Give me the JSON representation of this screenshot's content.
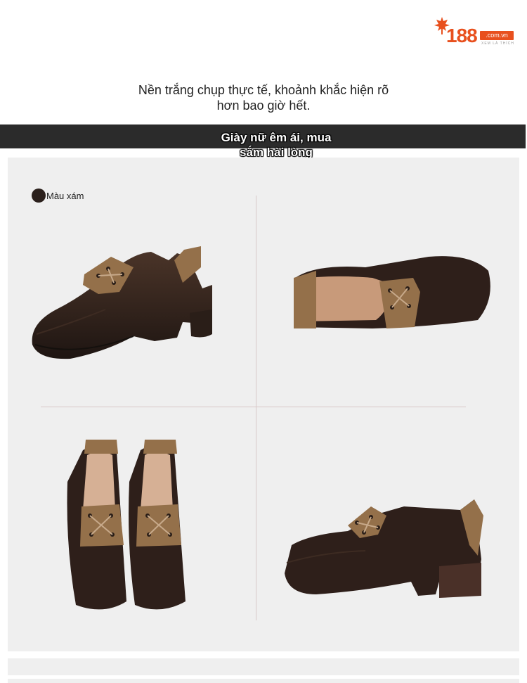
{
  "logo": {
    "number": "188",
    "domain": ".com.vn",
    "tagline": "XEM LÀ THÍCH"
  },
  "subtitle": {
    "line1": "Nền trắng chụp thực tế, khoảnh khắc hiện rõ",
    "line2": "hơn bao giờ hết."
  },
  "banner": {
    "line1": "Giày nữ êm ái, mua",
    "line2": "sắm hài lòng"
  },
  "color_option": {
    "label": "Màu xám",
    "swatch": "#2b201c"
  },
  "colors": {
    "brand": "#e8501e",
    "leather": "#2e1f1a",
    "suede": "#9a7550",
    "panel": "#efefef",
    "banner": "#2b2b2b"
  }
}
